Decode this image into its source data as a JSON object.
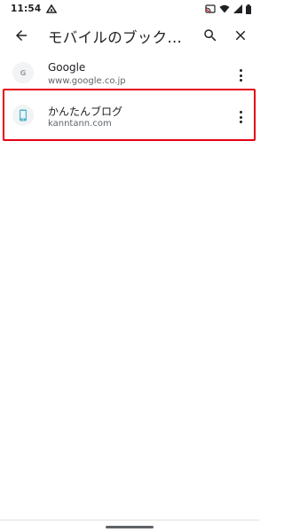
{
  "status_bar": {
    "time": "11:54"
  },
  "toolbar": {
    "title": "モバイルのブック…",
    "back_icon": "arrow-back-icon",
    "search_icon": "search-icon",
    "close_icon": "close-icon"
  },
  "bookmarks": [
    {
      "title": "Google",
      "url": "www.google.co.jp",
      "favicon_letter": "G",
      "favicon_icon": "google-favicon-icon"
    },
    {
      "title": "かんたんブログ",
      "url": "kanntann.com",
      "favicon_icon": "phone-favicon-icon"
    }
  ],
  "colors": {
    "highlight": "#e60012",
    "phone_favicon": "#4fb3c9"
  }
}
